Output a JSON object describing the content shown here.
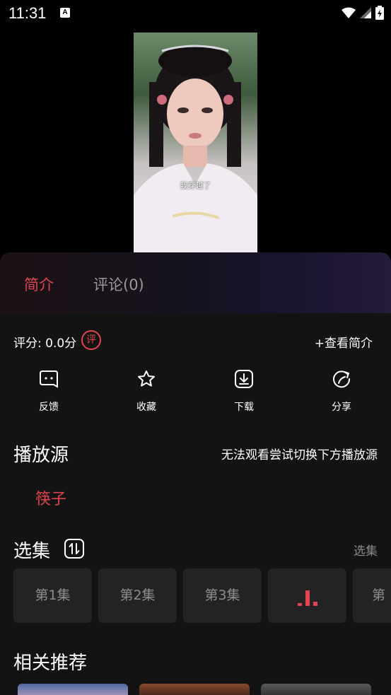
{
  "status_bar": {
    "time": "11:31",
    "notification_icon_text": "A"
  },
  "video": {
    "subtitle": "我穿越了"
  },
  "tabs": [
    {
      "label": "简介"
    },
    {
      "label": "评论(0)"
    }
  ],
  "info": {
    "rating_text": "评分: 0.0分",
    "rating_badge": "评",
    "view_intro": "+查看简介"
  },
  "actions": [
    {
      "label": "反馈",
      "icon": "feedback-icon"
    },
    {
      "label": "收藏",
      "icon": "star-icon"
    },
    {
      "label": "下载",
      "icon": "download-icon"
    },
    {
      "label": "分享",
      "icon": "share-icon"
    }
  ],
  "source": {
    "title": "播放源",
    "hint": "无法观看尝试切换下方播放源",
    "items": [
      "筷子"
    ]
  },
  "episodes": {
    "title": "选集",
    "more": "选集",
    "items": [
      "第1集",
      "第2集",
      "第3集",
      "",
      "第"
    ],
    "playing_index": 3
  },
  "recommend": {
    "title": "相关推荐"
  },
  "colors": {
    "accent": "#e0444f",
    "panel": "#131313",
    "episode_bg": "#232325"
  }
}
